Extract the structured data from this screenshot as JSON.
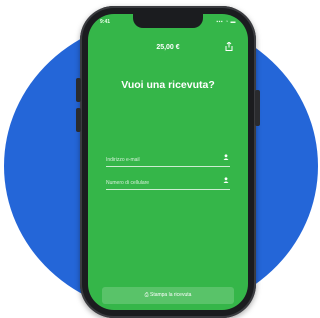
{
  "status_bar": {
    "time": "9:41",
    "icons": "▪▪▪ ◔ ▬"
  },
  "header": {
    "amount": "25,00 €",
    "share_icon": "share-icon"
  },
  "main": {
    "heading": "Vuoi una ricevuta?",
    "fields": [
      {
        "placeholder": "Indirizzo e-mail",
        "icon": "person-icon"
      },
      {
        "placeholder": "Numero di cellulare",
        "icon": "person-icon"
      }
    ]
  },
  "footer": {
    "print_button_label": "⎙ Stampa la ricevuta"
  },
  "colors": {
    "background_circle": "#2466d8",
    "screen_green": "#35b649",
    "phone_frame": "#1b1c1f"
  }
}
